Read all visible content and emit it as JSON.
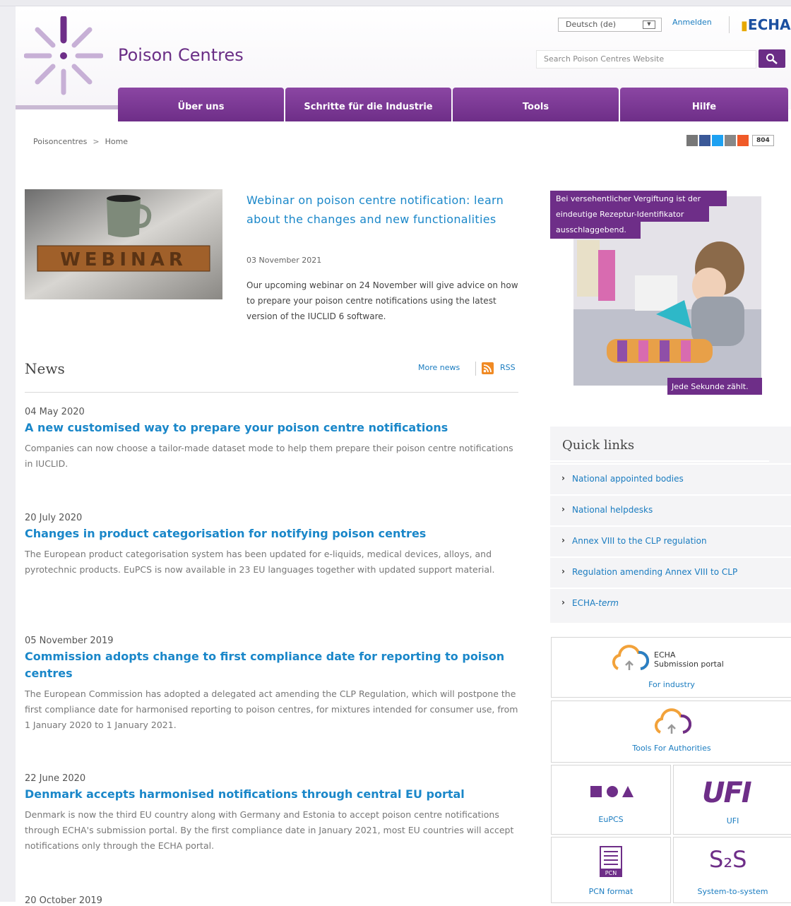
{
  "header": {
    "site_title": "Poison Centres",
    "language_selected": "Deutsch (de)",
    "login_label": "Anmelden",
    "org_logo_text": "ECHA",
    "search_placeholder": "Search Poison Centres Website"
  },
  "nav": {
    "tabs": [
      {
        "label": "Über uns"
      },
      {
        "label": "Schritte für die Industrie"
      },
      {
        "label": "Tools"
      },
      {
        "label": "Hilfe"
      }
    ]
  },
  "breadcrumb": {
    "items": [
      "Poisoncentres",
      "Home"
    ],
    "separator": ">"
  },
  "share": {
    "count": "804"
  },
  "featured": {
    "image_text": "WEBINAR",
    "title": "Webinar on poison centre notification: learn about the changes and new functionalities",
    "date": "03 November 2021",
    "summary": "Our upcoming webinar on 24 November will give advice on how to prepare your poison centre notifications using the latest version of the IUCLID 6 software."
  },
  "news": {
    "heading": "News",
    "more_label": "More news",
    "rss_label": "RSS",
    "items": [
      {
        "date": "04 May 2020",
        "title": "A new customised way to prepare your poison centre notifications",
        "summary": "Companies can now choose a tailor-made dataset mode to help them prepare their poison centre notifications in IUCLID."
      },
      {
        "date": "20 July 2020",
        "title": "Changes in product categorisation for notifying poison centres",
        "summary": "The European product categorisation system has been updated for e-liquids, medical devices, alloys, and pyrotechnic products. EuPCS is now available in 23 EU languages together with updated support material."
      },
      {
        "date": "05 November 2019",
        "title": "Commission adopts change to first compliance date for reporting to poison centres",
        "summary": "The European Commission has adopted a delegated act amending the CLP Regulation, which will postpone the first compliance date for harmonised reporting to poison centres, for mixtures intended for consumer use, from 1 January 2020 to 1 January 2021."
      },
      {
        "date": "22 June 2020",
        "title": "Denmark accepts harmonised notifications through central EU portal",
        "summary": "Denmark is now the third EU country along with Germany and Estonia to accept poison centre notifications through ECHA's submission portal. By the first compliance date in January 2021, most EU countries will accept notifications only through the ECHA portal."
      },
      {
        "date": "20 October 2019",
        "title": "",
        "summary": ""
      }
    ]
  },
  "promo": {
    "top_text": "Bei versehentlicher Vergiftung ist der eindeutige Rezeptur-Identifikator ausschlaggebend.",
    "top_lines": [
      "Bei versehentlicher Vergiftung ist der",
      "eindeutige Rezeptur-Identifikator",
      "ausschlaggebend."
    ],
    "bottom_text": "Jede Sekunde zählt."
  },
  "quick_links": {
    "heading": "Quick links",
    "items": [
      {
        "label": "National appointed bodies"
      },
      {
        "label": "National helpdesks"
      },
      {
        "label": "Annex VIII to the CLP regulation"
      },
      {
        "label": "Regulation amending Annex VIII to CLP"
      },
      {
        "label": "ECHA-",
        "label_em": "term"
      }
    ]
  },
  "tiles": {
    "portal": {
      "name_line1": "ECHA",
      "name_line2": "Submission portal",
      "caption": "For industry"
    },
    "authorities": {
      "caption": "Tools For Authorities"
    },
    "eupcs": {
      "caption": "EuPCS"
    },
    "ufi": {
      "logo_text": "UFI",
      "caption": "UFI"
    },
    "pcn": {
      "icon_text": "PCN",
      "caption": "PCN format"
    },
    "s2s": {
      "logo_text": "S₂S",
      "caption": "System-to-system"
    }
  },
  "colors": {
    "brand_purple": "#6e2e88",
    "link_blue": "#1a87c9",
    "rss_orange": "#f08a24"
  }
}
